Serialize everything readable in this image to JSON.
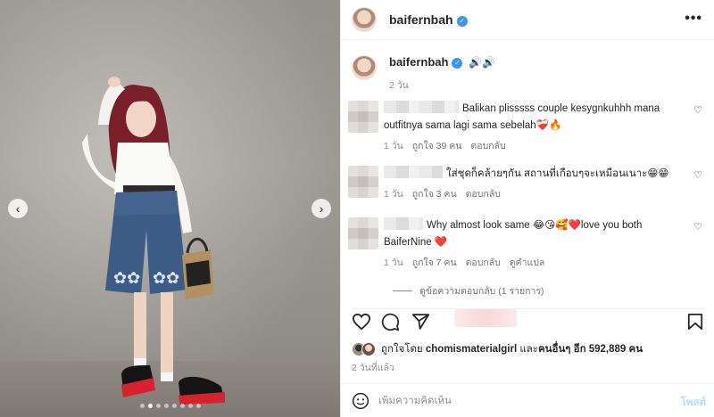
{
  "photo": {
    "prev_glyph": "‹",
    "next_glyph": "›",
    "carousel_total": 8,
    "carousel_active": 1
  },
  "header": {
    "username": "baifernbah",
    "verified_glyph": "✓",
    "more_glyph": "•••"
  },
  "caption": {
    "username": "baifernbah",
    "emojis": "🔊🔊",
    "time": "2 วัน"
  },
  "comments": [
    {
      "text_line1": "Balikan plisssss couple kesygnkuhhh mana",
      "text_line2": "outfitnya sama lagi sama sebelah❤️‍🩹🔥",
      "time": "1 วัน",
      "likes": "ถูกใจ 39 คน",
      "reply": "ตอบกลับ"
    },
    {
      "text_line1": "ใส่ชุดก็คล้ายๆกัน สถานที่เกือบๆจะเหมือนเนาะ😁😁",
      "time": "1 วัน",
      "likes": "ถูกใจ 3 คน",
      "reply": "ตอบกลับ"
    },
    {
      "text_line1": "Why almost look same 😂😘🥰❤️love you both",
      "text_line2": "BaiferNine ❤️",
      "time": "1 วัน",
      "likes": "ถูกใจ 7 คน",
      "reply": "ตอบกลับ",
      "translate": "ดูคำแปล"
    }
  ],
  "view_replies": "ดูข้อความตอบกลับ (1 รายการ)",
  "likes": {
    "prefix": "ถูกใจโดย",
    "user": "chomismaterialgirl",
    "middle": "และ",
    "others": "คนอื่นๆ อีก 592,889 คน"
  },
  "posted": "2 วันที่แล้ว",
  "add_comment": {
    "placeholder": "เพิ่มความคิดเห็น",
    "post_label": "โพสต์"
  }
}
